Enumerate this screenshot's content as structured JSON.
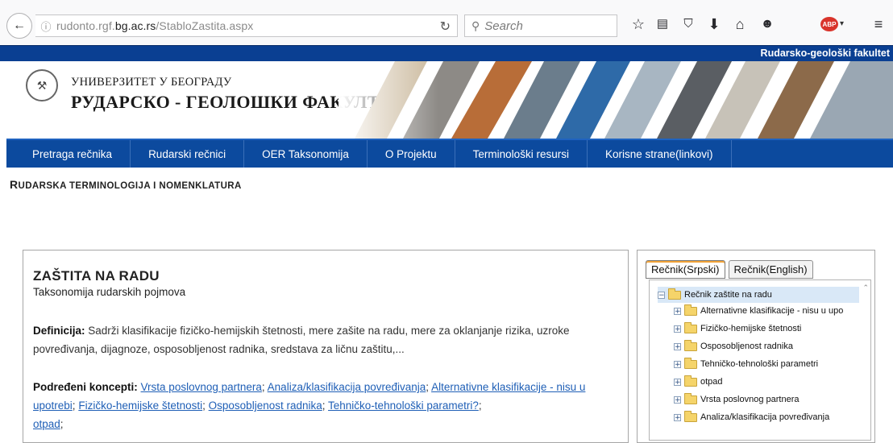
{
  "browser": {
    "url_prefix": "rudonto.rgf.",
    "url_domain": "bg.ac.rs",
    "url_path": "/StabloZastita.aspx",
    "search_placeholder": "Search",
    "abp_label": "ABP"
  },
  "site": {
    "top_strip_text": "Rudarsko-geološki fakultet",
    "university_line": "УНИВЕРЗИТЕТ У БЕОГРАДУ",
    "faculty_line": "РУДАРСКО - ГЕОЛОШКИ ФАКУЛТЕТ"
  },
  "nav": {
    "items": [
      "Pretraga rečnika",
      "Rudarski rečnici",
      "OER Taksonomija",
      "O Projektu",
      "Terminološki resursi",
      "Korisne strane(linkovi)"
    ]
  },
  "page": {
    "heading_first": "R",
    "heading_rest": "UDARSKA TERMINOLOGIJA I NOMENKLATURA"
  },
  "main": {
    "title": "ZAŠTITA NA RADU",
    "subtitle": "Taksonomija rudarskih pojmova",
    "definition_label": "Definicija:",
    "definition_text": " Sadrži klasifikacije fizičko-hemijskih štetnosti, mere zašite na radu, mere za oklanjanje rizika, uzroke povređivanja, dijagnoze, osposobljenost radnika, sredstava za ličnu zaštitu,...",
    "sub_concepts_label": "Podređeni koncepti:",
    "sub_concepts": [
      "Vrsta poslovnog partnera",
      "Analiza/klasifikacija povređivanja",
      "Alternativne klasifikacije - nisu u upotrebi",
      "Fizičko-hemijske štetnosti",
      "Osposobljenost radnika",
      "Tehničko-tehnološki parametri?",
      "otpad"
    ],
    "separator": ";"
  },
  "tree": {
    "tabs": [
      "Rečnik(Srpski)",
      "Rečnik(English)"
    ],
    "root": "Rečnik zaštite na radu",
    "items": [
      "Alternativne klasifikacije - nisu u upo",
      "Fizičko-hemijske štetnosti",
      "Osposobljenost radnika",
      "Tehničko-tehnološki parametri",
      "otpad",
      "Vrsta poslovnog partnera",
      "Analiza/klasifikacija povređivanja"
    ]
  }
}
